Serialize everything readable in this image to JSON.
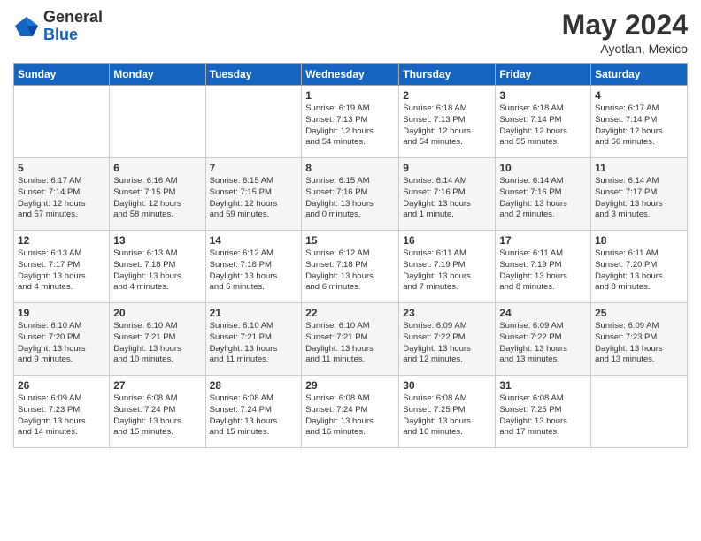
{
  "header": {
    "logo_general": "General",
    "logo_blue": "Blue",
    "month_year": "May 2024",
    "location": "Ayotlan, Mexico"
  },
  "days_of_week": [
    "Sunday",
    "Monday",
    "Tuesday",
    "Wednesday",
    "Thursday",
    "Friday",
    "Saturday"
  ],
  "weeks": [
    [
      {
        "day": "",
        "info": ""
      },
      {
        "day": "",
        "info": ""
      },
      {
        "day": "",
        "info": ""
      },
      {
        "day": "1",
        "info": "Sunrise: 6:19 AM\nSunset: 7:13 PM\nDaylight: 12 hours\nand 54 minutes."
      },
      {
        "day": "2",
        "info": "Sunrise: 6:18 AM\nSunset: 7:13 PM\nDaylight: 12 hours\nand 54 minutes."
      },
      {
        "day": "3",
        "info": "Sunrise: 6:18 AM\nSunset: 7:14 PM\nDaylight: 12 hours\nand 55 minutes."
      },
      {
        "day": "4",
        "info": "Sunrise: 6:17 AM\nSunset: 7:14 PM\nDaylight: 12 hours\nand 56 minutes."
      }
    ],
    [
      {
        "day": "5",
        "info": "Sunrise: 6:17 AM\nSunset: 7:14 PM\nDaylight: 12 hours\nand 57 minutes."
      },
      {
        "day": "6",
        "info": "Sunrise: 6:16 AM\nSunset: 7:15 PM\nDaylight: 12 hours\nand 58 minutes."
      },
      {
        "day": "7",
        "info": "Sunrise: 6:15 AM\nSunset: 7:15 PM\nDaylight: 12 hours\nand 59 minutes."
      },
      {
        "day": "8",
        "info": "Sunrise: 6:15 AM\nSunset: 7:16 PM\nDaylight: 13 hours\nand 0 minutes."
      },
      {
        "day": "9",
        "info": "Sunrise: 6:14 AM\nSunset: 7:16 PM\nDaylight: 13 hours\nand 1 minute."
      },
      {
        "day": "10",
        "info": "Sunrise: 6:14 AM\nSunset: 7:16 PM\nDaylight: 13 hours\nand 2 minutes."
      },
      {
        "day": "11",
        "info": "Sunrise: 6:14 AM\nSunset: 7:17 PM\nDaylight: 13 hours\nand 3 minutes."
      }
    ],
    [
      {
        "day": "12",
        "info": "Sunrise: 6:13 AM\nSunset: 7:17 PM\nDaylight: 13 hours\nand 4 minutes."
      },
      {
        "day": "13",
        "info": "Sunrise: 6:13 AM\nSunset: 7:18 PM\nDaylight: 13 hours\nand 4 minutes."
      },
      {
        "day": "14",
        "info": "Sunrise: 6:12 AM\nSunset: 7:18 PM\nDaylight: 13 hours\nand 5 minutes."
      },
      {
        "day": "15",
        "info": "Sunrise: 6:12 AM\nSunset: 7:18 PM\nDaylight: 13 hours\nand 6 minutes."
      },
      {
        "day": "16",
        "info": "Sunrise: 6:11 AM\nSunset: 7:19 PM\nDaylight: 13 hours\nand 7 minutes."
      },
      {
        "day": "17",
        "info": "Sunrise: 6:11 AM\nSunset: 7:19 PM\nDaylight: 13 hours\nand 8 minutes."
      },
      {
        "day": "18",
        "info": "Sunrise: 6:11 AM\nSunset: 7:20 PM\nDaylight: 13 hours\nand 8 minutes."
      }
    ],
    [
      {
        "day": "19",
        "info": "Sunrise: 6:10 AM\nSunset: 7:20 PM\nDaylight: 13 hours\nand 9 minutes."
      },
      {
        "day": "20",
        "info": "Sunrise: 6:10 AM\nSunset: 7:21 PM\nDaylight: 13 hours\nand 10 minutes."
      },
      {
        "day": "21",
        "info": "Sunrise: 6:10 AM\nSunset: 7:21 PM\nDaylight: 13 hours\nand 11 minutes."
      },
      {
        "day": "22",
        "info": "Sunrise: 6:10 AM\nSunset: 7:21 PM\nDaylight: 13 hours\nand 11 minutes."
      },
      {
        "day": "23",
        "info": "Sunrise: 6:09 AM\nSunset: 7:22 PM\nDaylight: 13 hours\nand 12 minutes."
      },
      {
        "day": "24",
        "info": "Sunrise: 6:09 AM\nSunset: 7:22 PM\nDaylight: 13 hours\nand 13 minutes."
      },
      {
        "day": "25",
        "info": "Sunrise: 6:09 AM\nSunset: 7:23 PM\nDaylight: 13 hours\nand 13 minutes."
      }
    ],
    [
      {
        "day": "26",
        "info": "Sunrise: 6:09 AM\nSunset: 7:23 PM\nDaylight: 13 hours\nand 14 minutes."
      },
      {
        "day": "27",
        "info": "Sunrise: 6:08 AM\nSunset: 7:24 PM\nDaylight: 13 hours\nand 15 minutes."
      },
      {
        "day": "28",
        "info": "Sunrise: 6:08 AM\nSunset: 7:24 PM\nDaylight: 13 hours\nand 15 minutes."
      },
      {
        "day": "29",
        "info": "Sunrise: 6:08 AM\nSunset: 7:24 PM\nDaylight: 13 hours\nand 16 minutes."
      },
      {
        "day": "30",
        "info": "Sunrise: 6:08 AM\nSunset: 7:25 PM\nDaylight: 13 hours\nand 16 minutes."
      },
      {
        "day": "31",
        "info": "Sunrise: 6:08 AM\nSunset: 7:25 PM\nDaylight: 13 hours\nand 17 minutes."
      },
      {
        "day": "",
        "info": ""
      }
    ]
  ]
}
